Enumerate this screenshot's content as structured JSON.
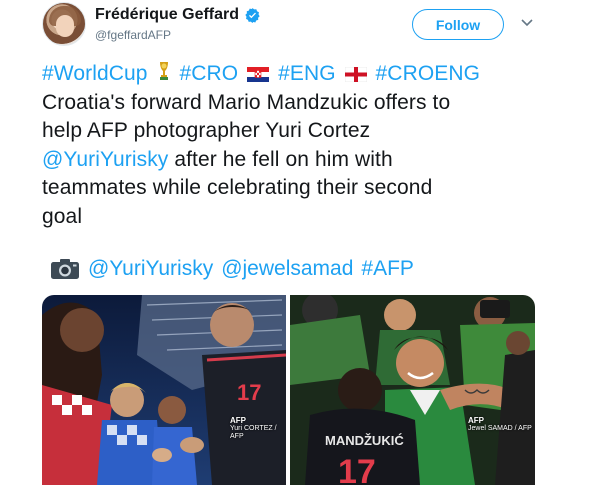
{
  "user": {
    "display_name": "Frédérique Geffard",
    "handle": "@fgeffardAFP",
    "verified": true,
    "avatar_icon": "avatar-photo"
  },
  "actions": {
    "follow_label": "Follow",
    "more_icon": "chevron-down-icon"
  },
  "tweet": {
    "hashtags": [
      "#WorldCup",
      "#CRO",
      "#ENG",
      "#CROENG"
    ],
    "line2": "Croatia's forward Mario Mandzukic  offers to",
    "line3": "help AFP photographer Yuri Cortez",
    "mention": "@YuriYurisky",
    "line4_rest": " after he fell on him with",
    "line5": "teammates while celebrating their second",
    "line6": "goal"
  },
  "credits": {
    "camera_icon": "camera-icon",
    "mention1": "@YuriYurisky",
    "mention2": "@jewelsamad",
    "hashtag": "#AFP"
  },
  "photos": [
    {
      "logo": "AFP",
      "credit": "Yuri CORTEZ / AFP"
    },
    {
      "logo": "AFP",
      "credit": "Jewel SAMAD / AFP",
      "jersey_name": "MANDŽUKIĆ",
      "jersey_number": "17"
    }
  ],
  "colors": {
    "link": "#1da1f2",
    "text": "#14171a",
    "secondary": "#657786"
  }
}
